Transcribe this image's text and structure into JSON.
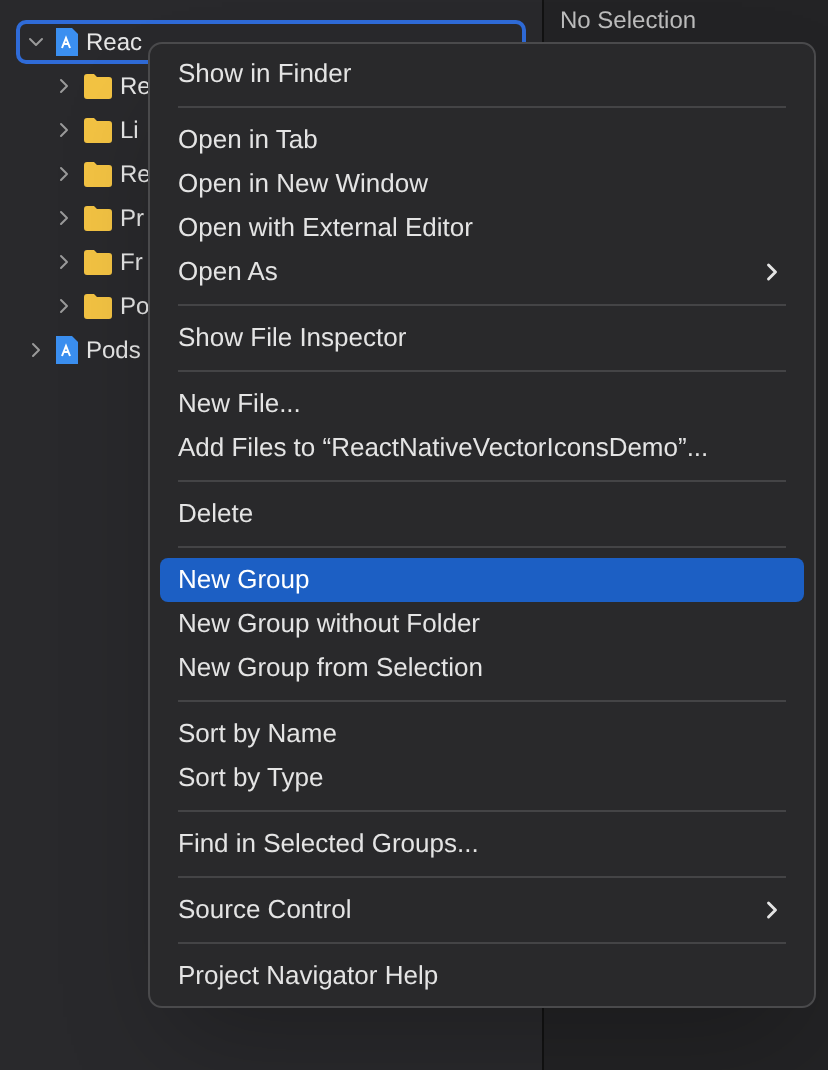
{
  "navigator": {
    "items": [
      {
        "label": "Reac",
        "kind": "project",
        "expanded": true,
        "selected": true,
        "children": [
          {
            "label": "Re",
            "kind": "folder",
            "expanded": false,
            "selected": false
          },
          {
            "label": "Li",
            "kind": "folder",
            "expanded": false,
            "selected": false
          },
          {
            "label": "Re",
            "kind": "folder",
            "expanded": false,
            "selected": false
          },
          {
            "label": "Pr",
            "kind": "folder",
            "expanded": false,
            "selected": false
          },
          {
            "label": "Fr",
            "kind": "folder",
            "expanded": false,
            "selected": false
          },
          {
            "label": "Po",
            "kind": "folder",
            "expanded": false,
            "selected": false
          }
        ]
      },
      {
        "label": "Pods",
        "kind": "project",
        "expanded": false,
        "selected": false
      }
    ]
  },
  "inspector": {
    "empty_text": "No Selection"
  },
  "context_menu": {
    "sections": [
      [
        {
          "label": "Show in Finder",
          "selected": false,
          "submenu": false
        }
      ],
      [
        {
          "label": "Open in Tab",
          "selected": false,
          "submenu": false
        },
        {
          "label": "Open in New Window",
          "selected": false,
          "submenu": false
        },
        {
          "label": "Open with External Editor",
          "selected": false,
          "submenu": false
        },
        {
          "label": "Open As",
          "selected": false,
          "submenu": true
        }
      ],
      [
        {
          "label": "Show File Inspector",
          "selected": false,
          "submenu": false
        }
      ],
      [
        {
          "label": "New File...",
          "selected": false,
          "submenu": false
        },
        {
          "label": "Add Files to “ReactNativeVectorIconsDemo”...",
          "selected": false,
          "submenu": false
        }
      ],
      [
        {
          "label": "Delete",
          "selected": false,
          "submenu": false
        }
      ],
      [
        {
          "label": "New Group",
          "selected": true,
          "submenu": false
        },
        {
          "label": "New Group without Folder",
          "selected": false,
          "submenu": false
        },
        {
          "label": "New Group from Selection",
          "selected": false,
          "submenu": false
        }
      ],
      [
        {
          "label": "Sort by Name",
          "selected": false,
          "submenu": false
        },
        {
          "label": "Sort by Type",
          "selected": false,
          "submenu": false
        }
      ],
      [
        {
          "label": "Find in Selected Groups...",
          "selected": false,
          "submenu": false
        }
      ],
      [
        {
          "label": "Source Control",
          "selected": false,
          "submenu": true
        }
      ],
      [
        {
          "label": "Project Navigator Help",
          "selected": false,
          "submenu": false
        }
      ]
    ]
  }
}
